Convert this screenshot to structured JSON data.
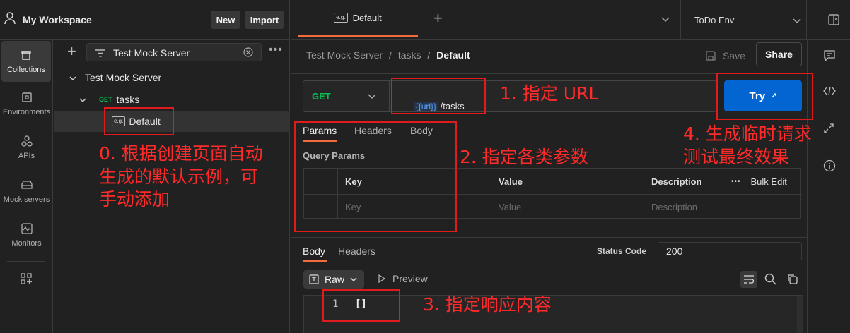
{
  "workspace": {
    "title": "My Workspace",
    "new_label": "New",
    "import_label": "Import"
  },
  "tab": {
    "label": "Default",
    "icon_text": "e.g."
  },
  "environment": {
    "selected": "ToDo Env"
  },
  "rail": {
    "items": [
      {
        "label": "Collections",
        "icon": "collections-icon"
      },
      {
        "label": "Environments",
        "icon": "environments-icon"
      },
      {
        "label": "APIs",
        "icon": "apis-icon"
      },
      {
        "label": "Mock servers",
        "icon": "mock-servers-icon"
      },
      {
        "label": "Monitors",
        "icon": "monitors-icon"
      }
    ]
  },
  "tree": {
    "filter_value": "Test Mock Server",
    "collection": "Test Mock Server",
    "request_method": "GET",
    "request_name": "tasks",
    "example_name": "Default"
  },
  "breadcrumb": {
    "part1": "Test Mock Server",
    "sep": "/",
    "part2": "tasks",
    "current": "Default"
  },
  "toolbar": {
    "save_label": "Save",
    "share_label": "Share"
  },
  "request": {
    "method": "GET",
    "url_variable": "{{url}}",
    "url_path": " /tasks",
    "try_label": "Try"
  },
  "request_tabs": [
    "Params",
    "Headers",
    "Body"
  ],
  "query_params": {
    "title": "Query Params",
    "headers": [
      "Key",
      "Value",
      "Description"
    ],
    "bulk_edit": "Bulk Edit",
    "placeholders": [
      "Key",
      "Value",
      "Description"
    ]
  },
  "response": {
    "tabs": [
      "Body",
      "Headers"
    ],
    "status_code_label": "Status Code",
    "status_code_value": "200",
    "format": "Raw",
    "preview_label": "Preview",
    "line_number": "1",
    "code": "[]"
  },
  "annotations": {
    "step0_line1": "0. 根据创建页面自动",
    "step0_line2": "生成的默认示例，可",
    "step0_line3": "手动添加",
    "step1": "1. 指定 URL",
    "step2": "2. 指定各类参数",
    "step3": "3. 指定响应内容",
    "step4_line1": "4. 生成临时请求",
    "step4_line2": "测试最终效果"
  },
  "colors": {
    "accent_blue": "#0265d2",
    "get_green": "#0cbb52",
    "annotation_red": "#ff2a2a",
    "tab_underline": "#f26b3a"
  }
}
